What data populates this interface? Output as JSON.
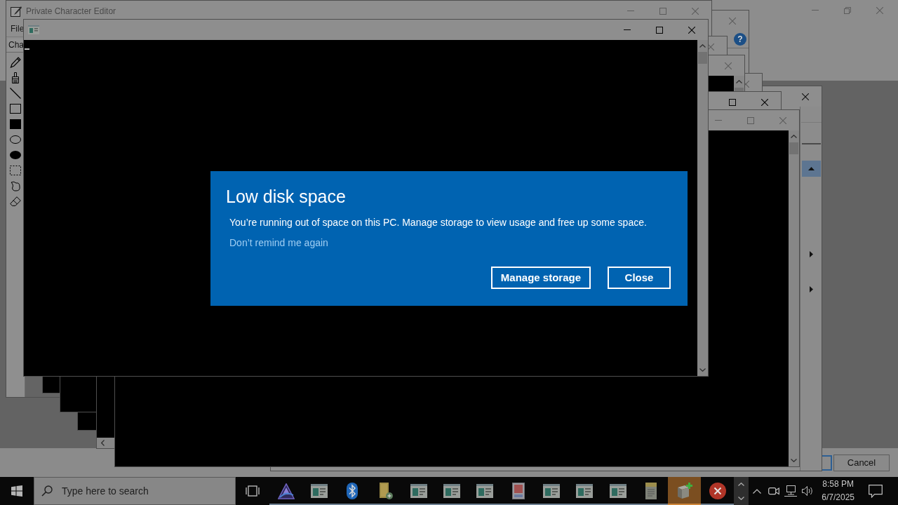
{
  "background_window": {
    "buttons": [
      "Cancel"
    ]
  },
  "help_window": {
    "help_button": "?"
  },
  "editor": {
    "title": "Private Character Editor",
    "menu": [
      "File"
    ],
    "toolbar_label": "Cha",
    "tools": [
      {
        "kind": "pencil"
      },
      {
        "kind": "brush"
      },
      {
        "kind": "line"
      },
      {
        "kind": "rectangle"
      },
      {
        "kind": "box"
      },
      {
        "kind": "ellipse"
      },
      {
        "kind": "disc"
      },
      {
        "kind": "select"
      },
      {
        "kind": "freeform"
      },
      {
        "kind": "eraser"
      }
    ]
  },
  "consoles": [
    {
      "kind": "plain",
      "active": true
    },
    {
      "kind": "plain",
      "active": false
    },
    {
      "kind": "plain",
      "active": false
    },
    {
      "kind": "plain",
      "active": false
    },
    {
      "kind": "scrollable",
      "active": true
    },
    {
      "kind": "plain",
      "active": false
    }
  ],
  "dialog": {
    "title": "Low disk space",
    "message": "You’re running out of space on this PC. Manage storage to view usage and free up some space.",
    "link": "Don’t remind me again",
    "buttons": [
      "Manage storage",
      "Close"
    ]
  },
  "taskbar": {
    "search": {
      "placeholder": "Type here to search"
    },
    "apps": [
      {
        "kind": "triangle",
        "selected": false,
        "running": true
      },
      {
        "kind": "window",
        "selected": false,
        "running": true
      },
      {
        "kind": "bluetooth",
        "selected": false,
        "running": true
      },
      {
        "kind": "file",
        "selected": false,
        "running": true
      },
      {
        "kind": "window",
        "selected": false,
        "running": true
      },
      {
        "kind": "window",
        "selected": false,
        "running": true
      },
      {
        "kind": "window",
        "selected": false,
        "running": true
      },
      {
        "kind": "document",
        "selected": false,
        "running": true
      },
      {
        "kind": "window",
        "selected": false,
        "running": true
      },
      {
        "kind": "window",
        "selected": false,
        "running": true
      },
      {
        "kind": "window",
        "selected": false,
        "running": true
      },
      {
        "kind": "notepad",
        "selected": false,
        "running": true
      },
      {
        "kind": "cube",
        "selected": true,
        "running": true
      },
      {
        "kind": "error",
        "selected": false,
        "running": true
      }
    ],
    "clock": {
      "time": "8:58 PM",
      "date": "6/7/2025"
    }
  }
}
